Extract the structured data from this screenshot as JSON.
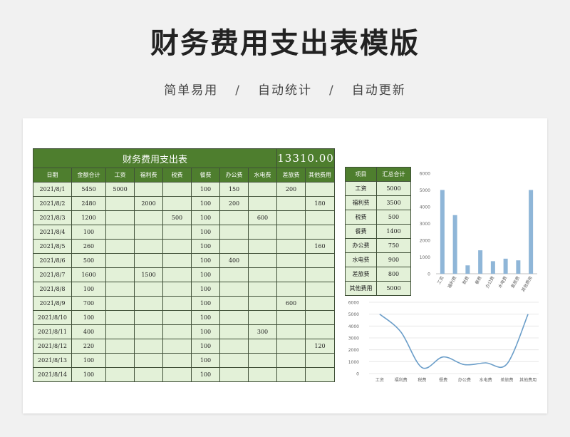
{
  "header": {
    "title": "财务费用支出表模版",
    "subtitle": [
      "简单易用",
      "自动统计",
      "自动更新"
    ],
    "separator": "/"
  },
  "sheet": {
    "table_title": "财务费用支出表",
    "total": "13310.00",
    "columns": [
      "日期",
      "金额合计",
      "工资",
      "福利费",
      "税费",
      "餐费",
      "办公费",
      "水电费",
      "差旅费",
      "其他费用"
    ],
    "rows": [
      [
        "2021/8/1",
        "5450",
        "5000",
        "",
        "",
        "100",
        "150",
        "",
        "200",
        ""
      ],
      [
        "2021/8/2",
        "2480",
        "",
        "2000",
        "",
        "100",
        "200",
        "",
        "",
        "180"
      ],
      [
        "2021/8/3",
        "1200",
        "",
        "",
        "500",
        "100",
        "",
        "600",
        "",
        ""
      ],
      [
        "2021/8/4",
        "100",
        "",
        "",
        "",
        "100",
        "",
        "",
        "",
        ""
      ],
      [
        "2021/8/5",
        "260",
        "",
        "",
        "",
        "100",
        "",
        "",
        "",
        "160"
      ],
      [
        "2021/8/6",
        "500",
        "",
        "",
        "",
        "100",
        "400",
        "",
        "",
        ""
      ],
      [
        "2021/8/7",
        "1600",
        "",
        "1500",
        "",
        "100",
        "",
        "",
        "",
        ""
      ],
      [
        "2021/8/8",
        "100",
        "",
        "",
        "",
        "100",
        "",
        "",
        "",
        ""
      ],
      [
        "2021/8/9",
        "700",
        "",
        "",
        "",
        "100",
        "",
        "",
        "600",
        ""
      ],
      [
        "2021/8/10",
        "100",
        "",
        "",
        "",
        "100",
        "",
        "",
        "",
        ""
      ],
      [
        "2021/8/11",
        "400",
        "",
        "",
        "",
        "100",
        "",
        "300",
        "",
        ""
      ],
      [
        "2021/8/12",
        "220",
        "",
        "",
        "",
        "100",
        "",
        "",
        "",
        "120"
      ],
      [
        "2021/8/13",
        "100",
        "",
        "",
        "",
        "100",
        "",
        "",
        "",
        ""
      ],
      [
        "2021/8/14",
        "100",
        "",
        "",
        "",
        "100",
        "",
        "",
        "",
        ""
      ]
    ]
  },
  "summary": {
    "headers": [
      "项目",
      "汇总合计"
    ],
    "rows": [
      [
        "工资",
        "5000"
      ],
      [
        "福利费",
        "3500"
      ],
      [
        "税费",
        "500"
      ],
      [
        "餐费",
        "1400"
      ],
      [
        "办公费",
        "750"
      ],
      [
        "水电费",
        "900"
      ],
      [
        "差旅费",
        "800"
      ],
      [
        "其他费用",
        "5000"
      ]
    ]
  },
  "chart_data": [
    {
      "type": "bar",
      "categories": [
        "工资",
        "福利费",
        "税费",
        "餐费",
        "办公费",
        "水电费",
        "差旅费",
        "其他费用"
      ],
      "values": [
        5000,
        3500,
        500,
        1400,
        750,
        900,
        800,
        5000
      ],
      "ylim": [
        0,
        6000
      ],
      "yticks": [
        0,
        1000,
        2000,
        3000,
        4000,
        5000,
        6000
      ],
      "grid": false,
      "color": "#8fb6d8"
    },
    {
      "type": "line",
      "categories": [
        "工资",
        "福利费",
        "税费",
        "餐费",
        "办公费",
        "水电费",
        "差旅费",
        "其他费用"
      ],
      "values": [
        5000,
        3500,
        500,
        1400,
        750,
        900,
        800,
        5000
      ],
      "ylim": [
        0,
        6000
      ],
      "yticks": [
        0,
        1000,
        2000,
        3000,
        4000,
        5000,
        6000
      ],
      "grid": true,
      "smooth": true,
      "color": "#6b9ec9"
    }
  ]
}
